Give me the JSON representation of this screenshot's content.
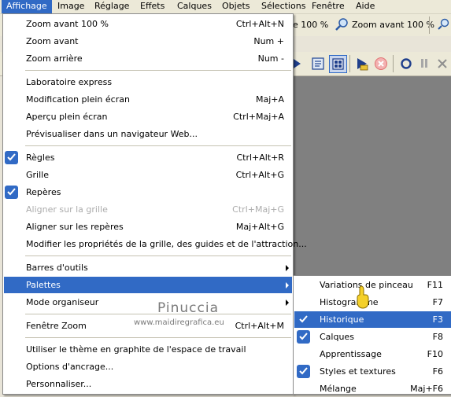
{
  "menubar": {
    "items": [
      {
        "label": "Affichage"
      },
      {
        "label": "Image"
      },
      {
        "label": "Réglage"
      },
      {
        "label": "Effets"
      },
      {
        "label": "Calques"
      },
      {
        "label": "Objets"
      },
      {
        "label": "Sélections"
      },
      {
        "label": "Fenêtre"
      },
      {
        "label": "Aide"
      }
    ]
  },
  "toolbar": {
    "zoom100_partial": "e 100 %",
    "zoom_in_100": "Zoom avant 100 %"
  },
  "main_menu": {
    "items": [
      {
        "label": "Zoom avant 100 %",
        "shortcut": "Ctrl+Alt+N"
      },
      {
        "label": "Zoom avant",
        "shortcut": "Num +"
      },
      {
        "label": "Zoom arrière",
        "shortcut": "Num -"
      },
      {
        "label": "Laboratoire express",
        "shortcut": ""
      },
      {
        "label": "Modification plein écran",
        "shortcut": "Maj+A"
      },
      {
        "label": "Aperçu plein écran",
        "shortcut": "Ctrl+Maj+A"
      },
      {
        "label": "Prévisualiser dans un navigateur Web...",
        "shortcut": ""
      },
      {
        "label": "Règles",
        "shortcut": "Ctrl+Alt+R",
        "checked": true
      },
      {
        "label": "Grille",
        "shortcut": "Ctrl+Alt+G"
      },
      {
        "label": "Repères",
        "shortcut": "",
        "checked": true
      },
      {
        "label": "Aligner sur la grille",
        "shortcut": "Ctrl+Maj+G",
        "disabled": true
      },
      {
        "label": "Aligner sur les repères",
        "shortcut": "Maj+Alt+G"
      },
      {
        "label": "Modifier les propriétés de la grille, des guides et de l'attraction...",
        "shortcut": ""
      },
      {
        "label": "Barres d'outils",
        "shortcut": ""
      },
      {
        "label": "Palettes",
        "shortcut": ""
      },
      {
        "label": "Mode organiseur",
        "shortcut": ""
      },
      {
        "label": "Fenêtre Zoom",
        "shortcut": "Ctrl+Alt+M"
      },
      {
        "label": "Utiliser le thème en graphite de l'espace de travail",
        "shortcut": ""
      },
      {
        "label": "Options d'ancrage...",
        "shortcut": ""
      },
      {
        "label": "Personnaliser...",
        "shortcut": ""
      }
    ]
  },
  "palettes_submenu": {
    "items": [
      {
        "label": "Variations de pinceau",
        "shortcut": "F11"
      },
      {
        "label": "Histogramme",
        "shortcut": "F7"
      },
      {
        "label": "Historique",
        "shortcut": "F3",
        "checked": true
      },
      {
        "label": "Calques",
        "shortcut": "F8",
        "checked": true
      },
      {
        "label": "Apprentissage",
        "shortcut": "F10"
      },
      {
        "label": "Styles et textures",
        "shortcut": "F6",
        "checked": true
      },
      {
        "label": "Mélange",
        "shortcut": "Maj+F6"
      }
    ]
  },
  "watermark": {
    "line1": "Pinuccia",
    "line2": "www.maidiregrafica.eu"
  },
  "colors": {
    "highlight": "#316ac5",
    "menu_bg": "#ffffff",
    "bar_bg": "#ece9d8",
    "workspace": "#808080",
    "disabled": "#acacac"
  }
}
